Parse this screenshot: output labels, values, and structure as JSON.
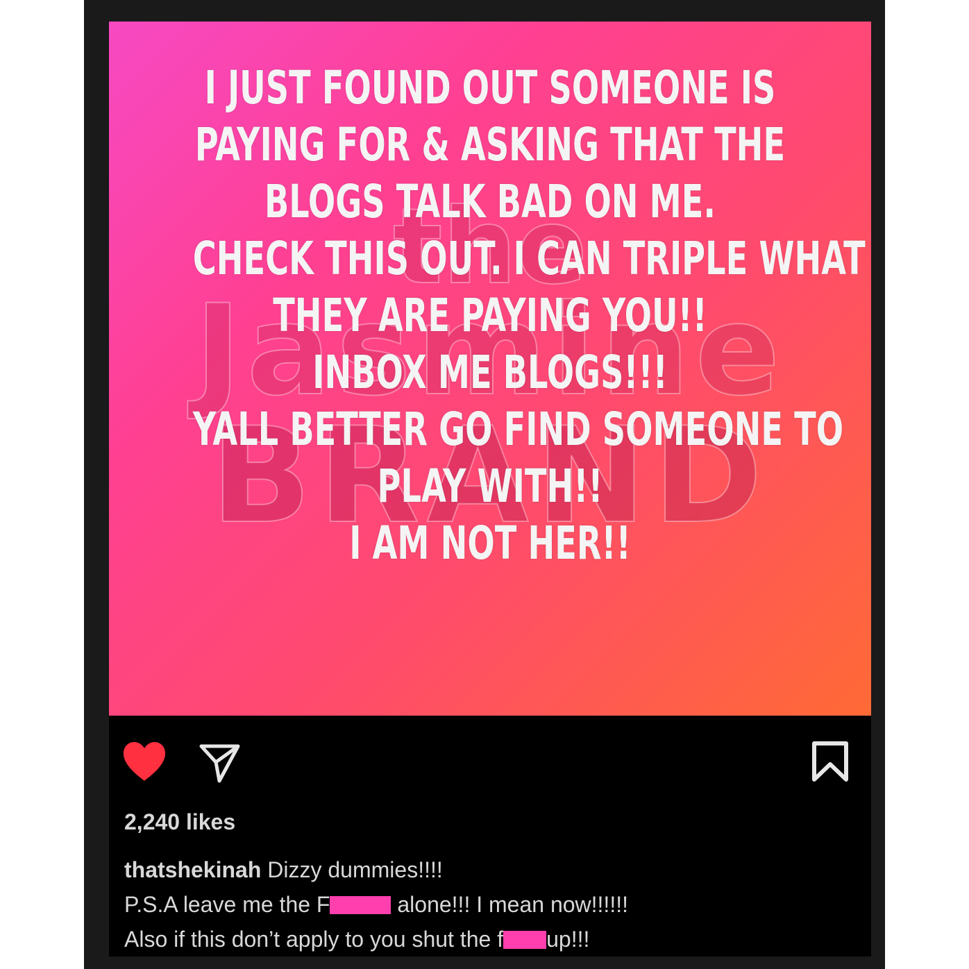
{
  "story": {
    "lines": [
      "I JUST FOUND OUT SOMEONE IS",
      "PAYING FOR & ASKING THAT THE",
      "BLOGS TALK BAD ON ME.",
      "CHECK THIS OUT. I CAN TRIPLE WHAT",
      "THEY ARE PAYING YOU!!",
      "INBOX ME BLOGS!!!",
      "YALL BETTER GO FIND SOMEONE TO",
      "PLAY WITH!!",
      "I AM NOT HER!!"
    ],
    "gradient_colors": [
      "#f749c3",
      "#ff4092",
      "#ff4a6e",
      "#ff6a35"
    ]
  },
  "watermark": {
    "line1": "the",
    "line2": "Jasmine",
    "line3": "BRAND"
  },
  "actions": {
    "like_icon": "heart-icon",
    "like_color": "#ff3040",
    "share_icon": "share-icon",
    "save_icon": "bookmark-icon"
  },
  "likes": "2,240 likes",
  "caption": {
    "username": "thatshekinah",
    "line1_text": " Dizzy dummies!!!!",
    "line2_before": "P.S.A leave me the F",
    "line2_after": " alone!!! I mean now!!!!!!",
    "line3_before": "Also if this don’t apply to you shut the f",
    "line3_after": "up!!!",
    "censor_color": "#ff3fae"
  }
}
